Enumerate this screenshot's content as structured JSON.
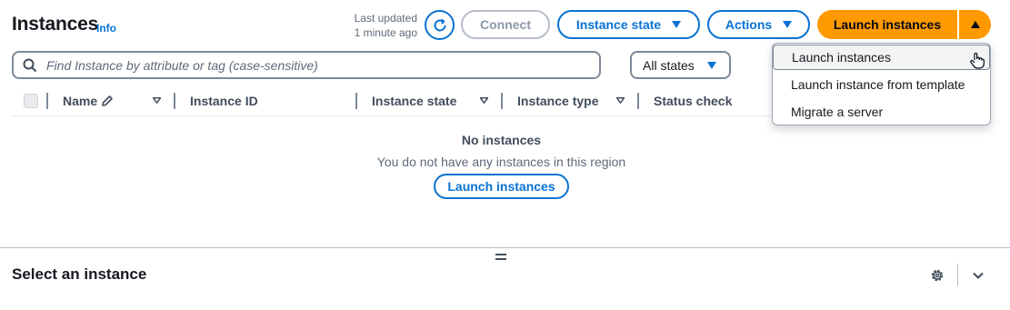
{
  "header": {
    "title": "Instances",
    "info_link": "Info",
    "last_updated_line1": "Last updated",
    "last_updated_line2": "1 minute ago"
  },
  "toolbar": {
    "connect_label": "Connect",
    "instance_state_label": "Instance state",
    "actions_label": "Actions",
    "launch_label": "Launch instances"
  },
  "filter": {
    "search_placeholder": "Find Instance by attribute or tag (case-sensitive)",
    "state_selected": "All states"
  },
  "table": {
    "columns": [
      "Name",
      "Instance ID",
      "Instance state",
      "Instance type",
      "Status check"
    ],
    "empty_title": "No instances",
    "empty_message": "You do not have any instances in this region",
    "empty_button": "Launch instances"
  },
  "launch_menu": {
    "items": [
      "Launch instances",
      "Launch instance from template",
      "Migrate a server"
    ]
  },
  "details_panel": {
    "title": "Select an instance"
  },
  "colors": {
    "accent": "#0972d3",
    "primary": "#ff9900",
    "text": "#16191f"
  }
}
